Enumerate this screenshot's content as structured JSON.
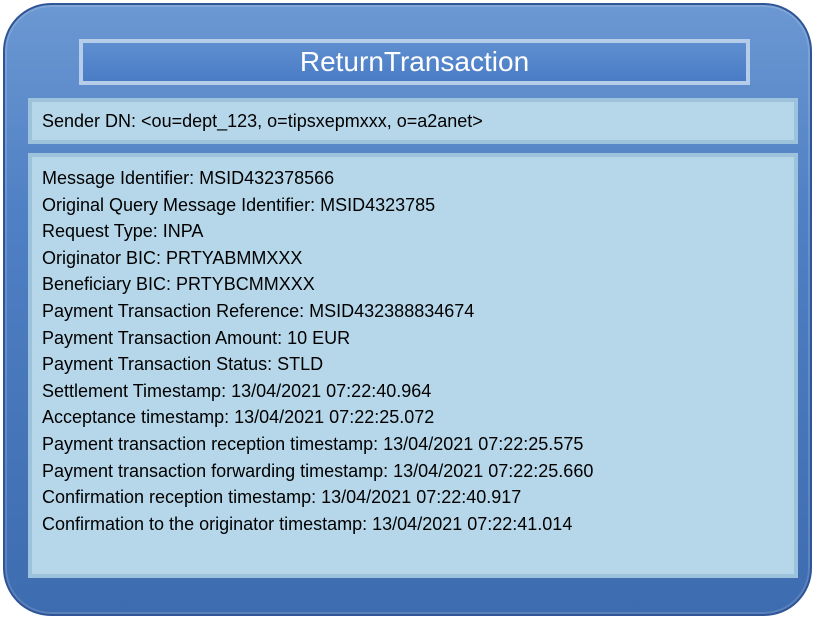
{
  "title": "ReturnTransaction",
  "sender": "Sender DN: <ou=dept_123, o=tipsxepmxxx, o=a2anet>",
  "details": [
    "Message Identifier: MSID432378566",
    "Original Query Message Identifier: MSID4323785",
    "Request Type: INPA",
    "Originator BIC: PRTYABMMXXX",
    "Beneficiary BIC: PRTYBCMMXXX",
    "Payment Transaction Reference: MSID432388834674",
    "Payment Transaction Amount: 10 EUR",
    "Payment Transaction Status: STLD",
    "Settlement Timestamp: 13/04/2021 07:22:40.964",
    "Acceptance timestamp: 13/04/2021 07:22:25.072",
    "Payment transaction reception timestamp: 13/04/2021 07:22:25.575",
    "Payment transaction forwarding timestamp: 13/04/2021 07:22:25.660",
    "Confirmation reception timestamp: 13/04/2021 07:22:40.917",
    "Confirmation to the originator timestamp: 13/04/2021 07:22:41.014"
  ],
  "colors": {
    "outer_fill": "#4f7fc4",
    "outer_border": "#2f5597",
    "inner_fill": "#b6d7ea",
    "inner_border": "#9dc3dc",
    "title_text": "#ffffff"
  }
}
